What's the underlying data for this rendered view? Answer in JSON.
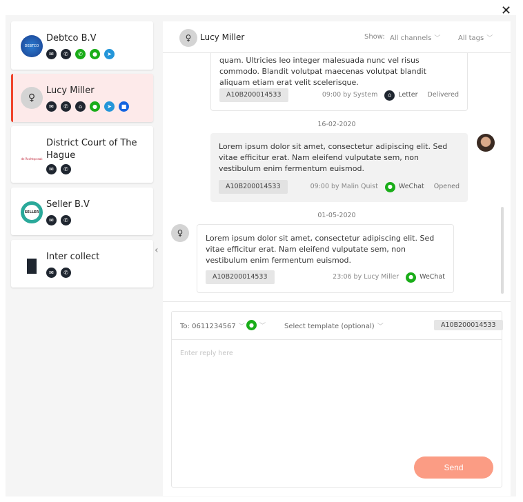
{
  "close_icon": "close-icon",
  "contacts": [
    {
      "name": "Debtco B.V",
      "logo_text": "DEBTCO",
      "channels": [
        "email",
        "phone",
        "whatsapp",
        "wechat",
        "telegram"
      ]
    },
    {
      "name": "Lucy Miller",
      "logo_text": "♀",
      "channels": [
        "email",
        "phone",
        "letter",
        "wechat",
        "telegram",
        "chat"
      ],
      "active": true
    },
    {
      "name": "District Court of The Hague",
      "logo_text": "de Rechtspraak",
      "channels": [
        "email",
        "phone"
      ]
    },
    {
      "name": "Seller B.V",
      "logo_text": "SELLER",
      "channels": [
        "email",
        "phone"
      ]
    },
    {
      "name": "Inter collect",
      "logo_text": "",
      "channels": [
        "email",
        "phone"
      ]
    }
  ],
  "header": {
    "name": "Lucy Miller",
    "show_label": "Show:",
    "channels_filter": "All channels",
    "tags_filter": "All tags"
  },
  "messages": [
    {
      "text": "quam. Ultricies leo integer malesuada nunc vel risus commodo. Blandit volutpat maecenas volutpat blandit aliquam etiam erat velit scelerisque.",
      "tag": "A10B200014533",
      "meta": "09:00 by System",
      "channel": "Letter",
      "status": "Delivered"
    },
    {
      "date": "16-02-2020",
      "text": "Lorem ipsum dolor sit amet, consectetur adipiscing elit. Sed vitae efficitur erat. Nam eleifend vulputate sem, non vestibulum enim fermentum euismod.",
      "tag": "A10B200014533",
      "meta": "09:00 by Malin Quist",
      "channel": "WeChat",
      "status": "Opened"
    },
    {
      "date": "01-05-2020",
      "text": "Lorem ipsum dolor sit amet, consectetur adipiscing elit. Sed vitae efficitur erat. Nam eleifend vulputate sem, non vestibulum enim fermentum euismod.",
      "tag": "A10B200014533",
      "meta": "23:06  by Lucy Miller",
      "channel": "WeChat"
    }
  ],
  "compose": {
    "to_label": "To:",
    "to_value": "0611234567",
    "template_placeholder": "Select template (optional)",
    "tag": "A10B200014533",
    "reply_placeholder": "Enter reply here",
    "send_label": "Send"
  },
  "colors": {
    "accent": "#f0442c",
    "send": "#fb9c84",
    "wechat": "#1aad19",
    "telegram": "#2496d9",
    "dark_icon": "#1f2630"
  }
}
